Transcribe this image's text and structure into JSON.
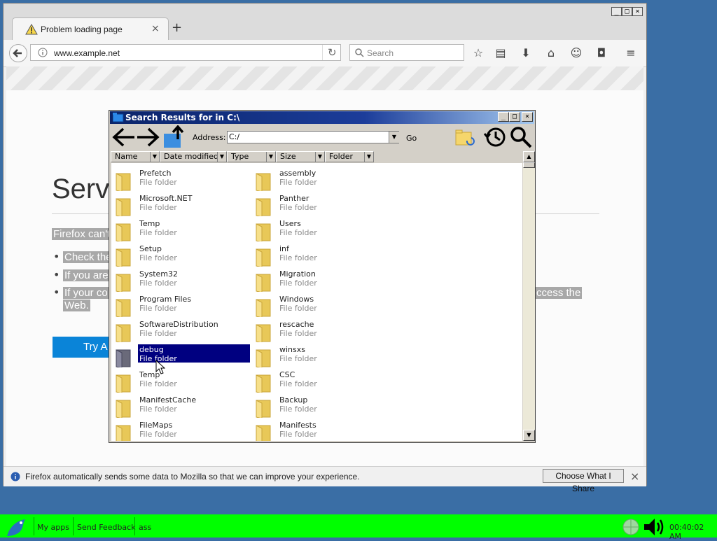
{
  "browser": {
    "tab": {
      "title": "Problem loading page",
      "close": "×",
      "new_tab": "+"
    },
    "window_controls": {
      "minimize": "_",
      "maximize": "□",
      "close": "×"
    },
    "url": "www.example.net",
    "search_placeholder": "Search",
    "page": {
      "title": "Serve",
      "line1": "Firefox can't",
      "bullet1": "Check the",
      "bullet2": "If you are",
      "bullet3a": "If your co",
      "bullet3b": "ccess the",
      "bullet3c": "Web.",
      "try_again": "Try A"
    },
    "notification": {
      "message": "Firefox automatically sends some data to Mozilla so that we can improve your experience.",
      "button": "Choose What I Share",
      "close": "×"
    }
  },
  "search_window": {
    "title": "Search Results for  in C:\\",
    "address_label": "Address:",
    "address_value": "C:/",
    "go_label": "Go",
    "columns": [
      "Name",
      "Date modified",
      "Type",
      "Size",
      "Folder"
    ],
    "items_left": [
      {
        "name": "Prefetch",
        "type": "File folder"
      },
      {
        "name": "Microsoft.NET",
        "type": "File folder"
      },
      {
        "name": "Temp",
        "type": "File folder"
      },
      {
        "name": "Setup",
        "type": "File folder"
      },
      {
        "name": "System32",
        "type": "File folder"
      },
      {
        "name": "Program Files",
        "type": "File folder"
      },
      {
        "name": "SoftwareDistribution",
        "type": "File folder"
      },
      {
        "name": "debug",
        "type": "File folder"
      },
      {
        "name": "Temp",
        "type": "File folder"
      },
      {
        "name": "ManifestCache",
        "type": "File folder"
      },
      {
        "name": "FileMaps",
        "type": "File folder"
      }
    ],
    "items_right": [
      {
        "name": "assembly",
        "type": "File folder"
      },
      {
        "name": "Panther",
        "type": "File folder"
      },
      {
        "name": "Users",
        "type": "File folder"
      },
      {
        "name": "inf",
        "type": "File folder"
      },
      {
        "name": "Migration",
        "type": "File folder"
      },
      {
        "name": "Windows",
        "type": "File folder"
      },
      {
        "name": "rescache",
        "type": "File folder"
      },
      {
        "name": "winsxs",
        "type": "File folder"
      },
      {
        "name": "CSC",
        "type": "File folder"
      },
      {
        "name": "Backup",
        "type": "File folder"
      },
      {
        "name": "Manifests",
        "type": "File folder"
      }
    ]
  },
  "taskbar": {
    "my_apps": "My apps",
    "send_feedback": "Send Feedback",
    "ass": "ass",
    "clock": "00:40:02 AM"
  },
  "colors": {
    "desktop": "#3a6ea5",
    "taskbar": "#00ff00",
    "title_gradient_start": "#0a246a",
    "selection": "#000080",
    "try_again": "#0a84d8"
  }
}
